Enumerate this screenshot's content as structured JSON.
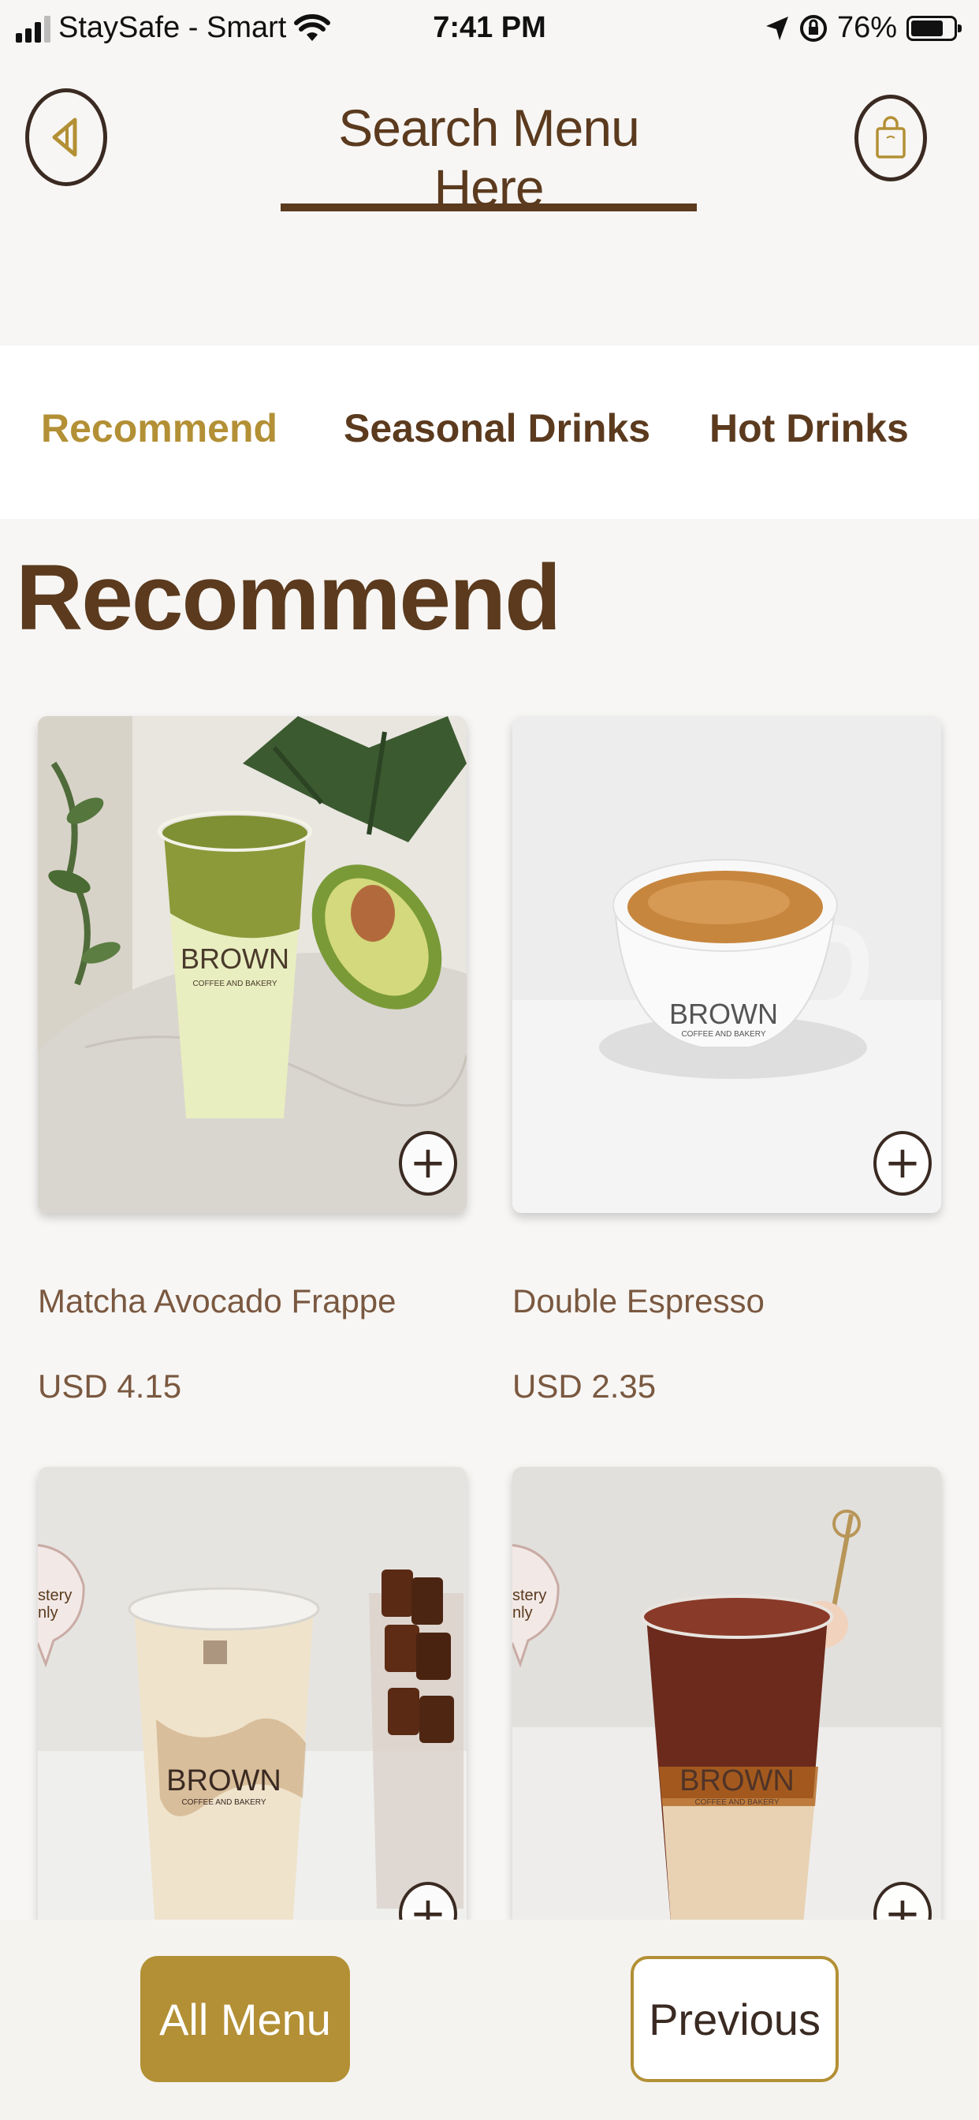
{
  "status_bar": {
    "carrier": "StaySafe - Smart",
    "time": "7:41 PM",
    "battery": "76%",
    "battery_level": 0.76
  },
  "header": {
    "search_title": "Search Menu Here",
    "back_icon": "back-triangle-icon",
    "bag_icon": "shopping-bag-icon"
  },
  "tabs": [
    {
      "label": "Recommend",
      "active": true
    },
    {
      "label": "Seasonal Drinks",
      "active": false
    },
    {
      "label": "Hot Drinks",
      "active": false
    }
  ],
  "section_title": "Recommend",
  "products": [
    {
      "name": "Matcha Avocado Frappe",
      "price": "USD 4.15"
    },
    {
      "name": "Double Espresso",
      "price": "USD 2.35"
    },
    {
      "name": "",
      "price": "",
      "badge": "stery\nnly"
    },
    {
      "name": "",
      "price": "",
      "badge": "stery\nnly"
    }
  ],
  "brand": {
    "logo_text": "BROWN",
    "logo_sub": "COFFEE AND BAKERY"
  },
  "add_icon": "+",
  "bottom": {
    "all_menu": "All Menu",
    "previous": "Previous"
  },
  "colors": {
    "accent": "#b39035",
    "brown": "#5b3a1e"
  }
}
